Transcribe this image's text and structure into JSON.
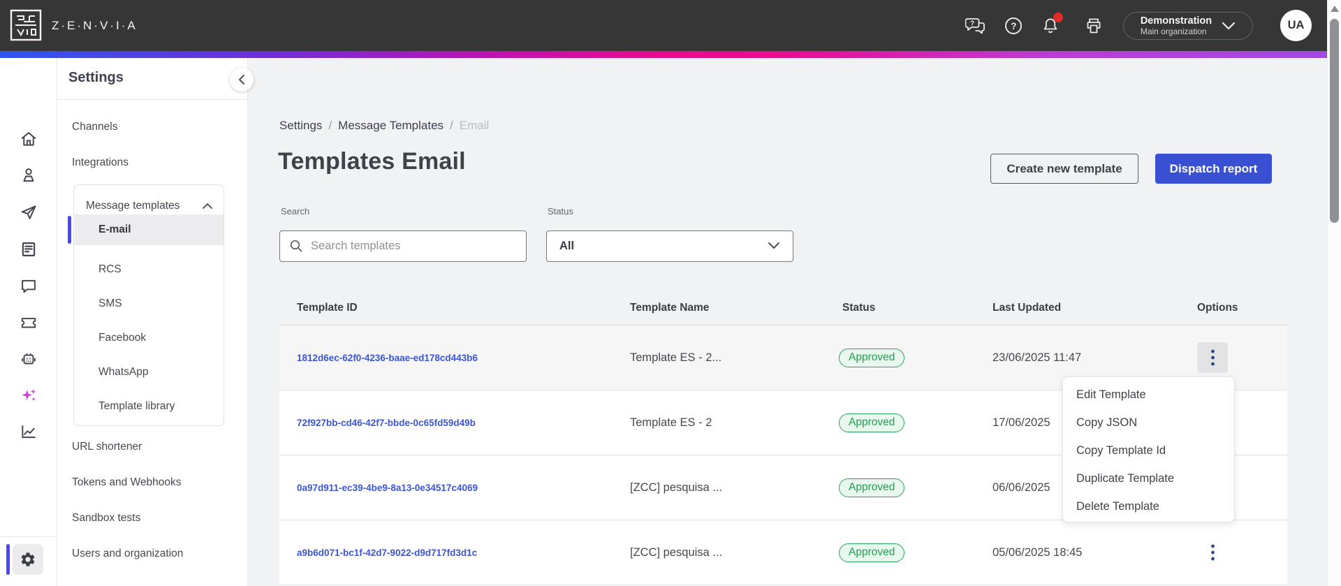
{
  "topbar": {
    "brand": "Z·E·N·V·I·A",
    "icons": [
      "feedback-chat-icon",
      "help-icon",
      "notifications-bell-icon",
      "print-icon"
    ],
    "org": {
      "name": "Demonstration",
      "sub": "Main organization"
    },
    "avatar": "UA"
  },
  "rail": {
    "icons": [
      "home-icon",
      "contacts-icon",
      "send-icon",
      "documents-icon",
      "chat-icon",
      "ticket-icon",
      "bot-icon",
      "ai-sparkles-icon",
      "analytics-icon",
      "settings-gear-icon"
    ]
  },
  "panel": {
    "title": "Settings",
    "items": {
      "channels": "Channels",
      "integrations": "Integrations"
    },
    "group": {
      "label": "Message templates",
      "children": [
        "E-mail",
        "RCS",
        "SMS",
        "Facebook",
        "WhatsApp",
        "Template library"
      ],
      "active": "E-mail"
    },
    "items_after": [
      "URL shortener",
      "Tokens and Webhooks",
      "Sandbox tests",
      "Users and organization"
    ]
  },
  "main": {
    "breadcrumb": {
      "items": [
        "Settings",
        "Message Templates",
        "Email"
      ],
      "separator": "/"
    },
    "title": "Templates Email",
    "actions": {
      "create": "Create new template",
      "dispatch": "Dispatch report"
    },
    "filters": {
      "search_label": "Search",
      "search_placeholder": "Search templates",
      "status_label": "Status",
      "status_value": "All"
    },
    "table": {
      "columns": [
        "Template ID",
        "Template Name",
        "Status",
        "Last Updated",
        "Options"
      ],
      "rows": [
        {
          "id": "1812d6ec-62f0-4236-baae-ed178cd443b6",
          "name": "Template ES - 2...",
          "status": "Approved",
          "updated": "23/06/2025 11:47"
        },
        {
          "id": "72f927bb-cd46-42f7-bbde-0c65fd59d49b",
          "name": "Template ES - 2",
          "status": "Approved",
          "updated": "17/06/2025"
        },
        {
          "id": "0a97d911-ec39-4be9-8a13-0e34517c4069",
          "name": "[ZCC] pesquisa ...",
          "status": "Approved",
          "updated": "06/06/2025"
        },
        {
          "id": "a9b6d071-bc1f-42d7-9022-d9d717fd3d1c",
          "name": "[ZCC] pesquisa ...",
          "status": "Approved",
          "updated": "05/06/2025 18:45"
        }
      ]
    },
    "context_menu": [
      "Edit Template",
      "Copy JSON",
      "Copy Template Id",
      "Duplicate Template",
      "Delete Template"
    ]
  },
  "colors": {
    "topbar_bg": "#363636",
    "primary_blue": "#3950d2",
    "link_blue": "#3c55d6",
    "active_indicator": "#4845ff",
    "success_green": "#1f9e50",
    "success_bg": "#e9f8ee",
    "notification_red": "#e02b2b",
    "gradient": [
      "#2e55ee",
      "#6e2fd8",
      "#ea0b8c",
      "#a04ae6"
    ]
  }
}
